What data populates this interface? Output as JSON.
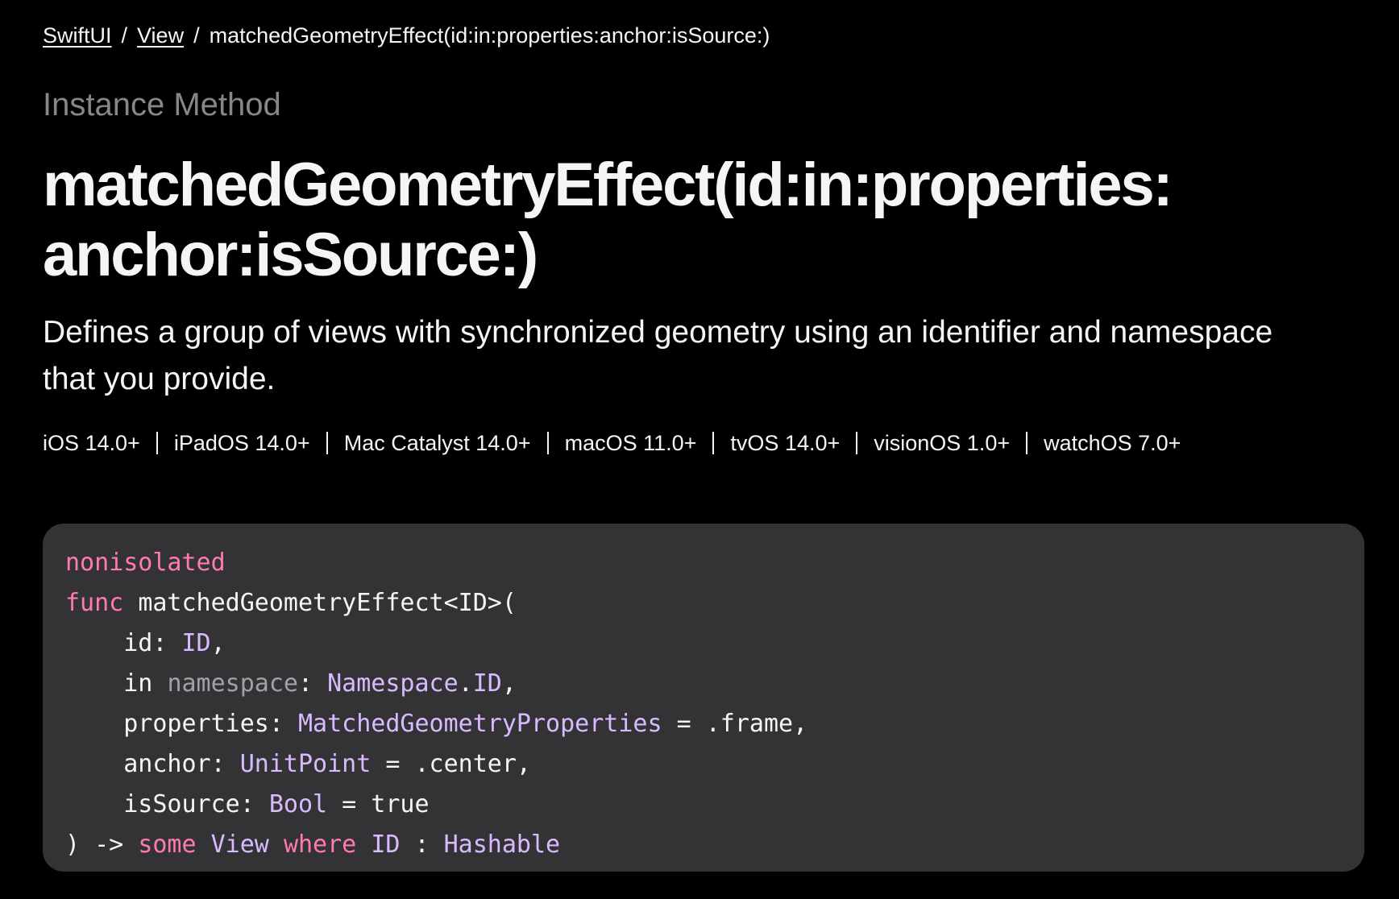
{
  "breadcrumb": {
    "items": [
      "SwiftUI",
      "View"
    ],
    "current": "matchedGeometryEffect(id:in:properties:anchor:isSource:)",
    "separator": "/"
  },
  "eyebrow": "Instance Method",
  "title": {
    "line1": "matchedGeometryEffect(id:in:properties:",
    "line2": "anchor:isSource:)"
  },
  "abstract": {
    "line1": "Defines a group of views with synchronized geometry using an identifier and namespace",
    "line2": "that you provide."
  },
  "availability": [
    "iOS 14.0+",
    "iPadOS 14.0+",
    "Mac Catalyst 14.0+",
    "macOS 11.0+",
    "tvOS 14.0+",
    "visionOS 1.0+",
    "watchOS 7.0+"
  ],
  "declaration": {
    "modifier": "nonisolated",
    "func_kw": "func",
    "func_name": "matchedGeometryEffect<ID>(",
    "indent": "    ",
    "params": {
      "id_label": "id: ",
      "id_type": "ID",
      "comma": ",",
      "in_label": "in ",
      "in_name": "namespace",
      "colon": ": ",
      "ns_type": "Namespace",
      "dot": ".",
      "ns_id": "ID",
      "properties_label": "properties: ",
      "properties_type": "MatchedGeometryProperties",
      "properties_default": " = .frame,",
      "anchor_label": "anchor: ",
      "anchor_type": "UnitPoint",
      "anchor_default": " = .center,",
      "issource_label": "isSource: ",
      "issource_type": "Bool",
      "issource_default": " = true"
    },
    "return": {
      "arrow": ") -> ",
      "some": "some",
      "space": " ",
      "view": "View",
      "where": "where",
      "id": "ID",
      "colon": " : ",
      "hashable": "Hashable"
    }
  },
  "colors": {
    "background": "#000000",
    "text": "#f5f5f7",
    "muted": "#86868b",
    "code_background": "#333336",
    "keyword": "#ff7ab2",
    "type": "#dabaff"
  }
}
